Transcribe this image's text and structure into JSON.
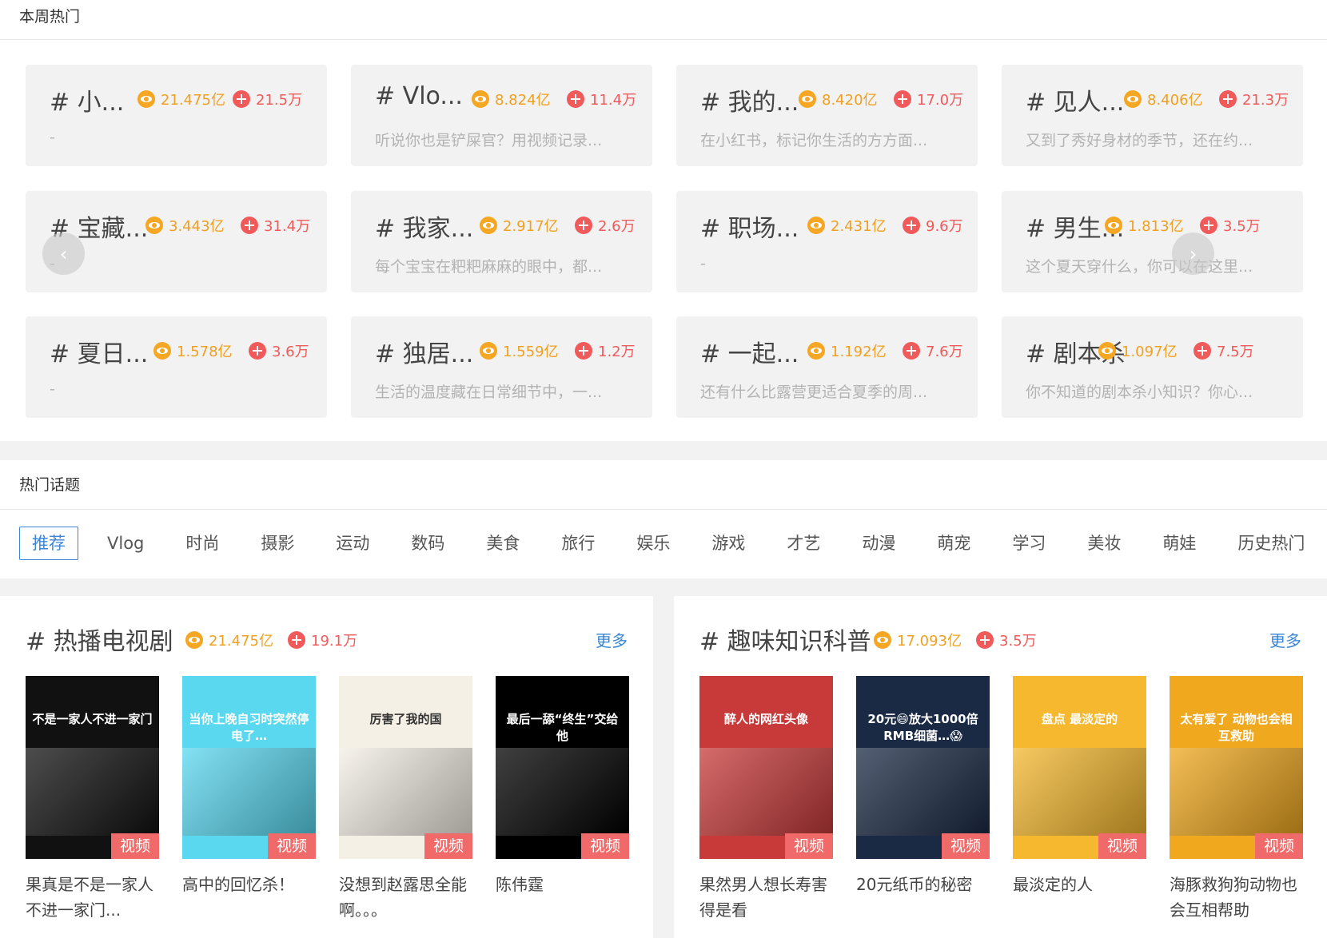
{
  "weekly": {
    "title": "本周热门",
    "cards": [
      {
        "title": "# 小...",
        "views": "21.475亿",
        "adds": "21.5万",
        "desc": "-"
      },
      {
        "title": "# Vlo...",
        "views": "8.824亿",
        "adds": "11.4万",
        "desc": "听说你也是铲屎官？用视频记录..."
      },
      {
        "title": "# 我的...",
        "views": "8.420亿",
        "adds": "17.0万",
        "desc": "在小红书，标记你生活的方方面..."
      },
      {
        "title": "# 见人...",
        "views": "8.406亿",
        "adds": "21.3万",
        "desc": "又到了秀好身材的季节，还在约..."
      },
      {
        "title": "# 宝藏...",
        "views": "3.443亿",
        "adds": "31.4万",
        "desc": "-"
      },
      {
        "title": "# 我家...",
        "views": "2.917亿",
        "adds": "2.6万",
        "desc": "每个宝宝在粑粑麻麻的眼中，都..."
      },
      {
        "title": "# 职场...",
        "views": "2.431亿",
        "adds": "9.6万",
        "desc": "-"
      },
      {
        "title": "# 男生...",
        "views": "1.813亿",
        "adds": "3.5万",
        "desc": "这个夏天穿什么，你可以在这里..."
      },
      {
        "title": "# 夏日...",
        "views": "1.578亿",
        "adds": "3.6万",
        "desc": "-"
      },
      {
        "title": "# 独居...",
        "views": "1.559亿",
        "adds": "1.2万",
        "desc": "生活的温度藏在日常细节中，一..."
      },
      {
        "title": "# 一起...",
        "views": "1.192亿",
        "adds": "7.6万",
        "desc": "还有什么比露营更适合夏季的周..."
      },
      {
        "title": "# 剧本杀",
        "views": "1.097亿",
        "adds": "7.5万",
        "desc": "你不知道的剧本杀小知识？你心..."
      }
    ],
    "prev_arrow": "‹",
    "next_arrow": "›"
  },
  "topics": {
    "title": "热门话题",
    "tabs": [
      "推荐",
      "Vlog",
      "时尚",
      "摄影",
      "运动",
      "数码",
      "美食",
      "旅行",
      "娱乐",
      "游戏",
      "才艺",
      "动漫",
      "萌宠",
      "学习",
      "美妆",
      "萌娃",
      "历史热门"
    ],
    "active_tab": "推荐"
  },
  "sections": [
    {
      "title": "# 热播电视剧",
      "views": "21.475亿",
      "adds": "19.1万",
      "more": "更多",
      "videos": [
        {
          "caption": "不是一家人不进一家门",
          "badge": "视频",
          "title": "果真是不是一家人 不进一家门...",
          "bg": "#111111"
        },
        {
          "caption": "当你上晚自习时突然停电了…",
          "badge": "视频",
          "title": "高中的回忆杀！",
          "bg": "#5ad8f0"
        },
        {
          "caption": "厉害了我的国",
          "badge": "视频",
          "title": "没想到赵露思全能啊。。。",
          "bg": "#f4f0e6"
        },
        {
          "caption": "最后一舔“终生”交给他",
          "badge": "视频",
          "title": "陈伟霆",
          "bg": "#000000"
        }
      ]
    },
    {
      "title": "# 趣味知识科普",
      "views": "17.093亿",
      "adds": "3.5万",
      "more": "更多",
      "videos": [
        {
          "caption": "醉人的网红头像",
          "badge": "视频",
          "title": "果然男人想长寿害得是看",
          "bg": "#c83a3a"
        },
        {
          "caption": "20元😄放大1000倍 RMB细菌…😱",
          "badge": "视频",
          "title": "20元纸币的秘密",
          "bg": "#1a2a44"
        },
        {
          "caption": "盘点 最淡定的",
          "badge": "视频",
          "title": "最淡定的人",
          "bg": "#f5b82e"
        },
        {
          "caption": "太有爱了 动物也会相互救助",
          "badge": "视频",
          "title": "海豚救狗狗动物也会互相帮助",
          "bg": "#f0a81e"
        }
      ]
    }
  ]
}
